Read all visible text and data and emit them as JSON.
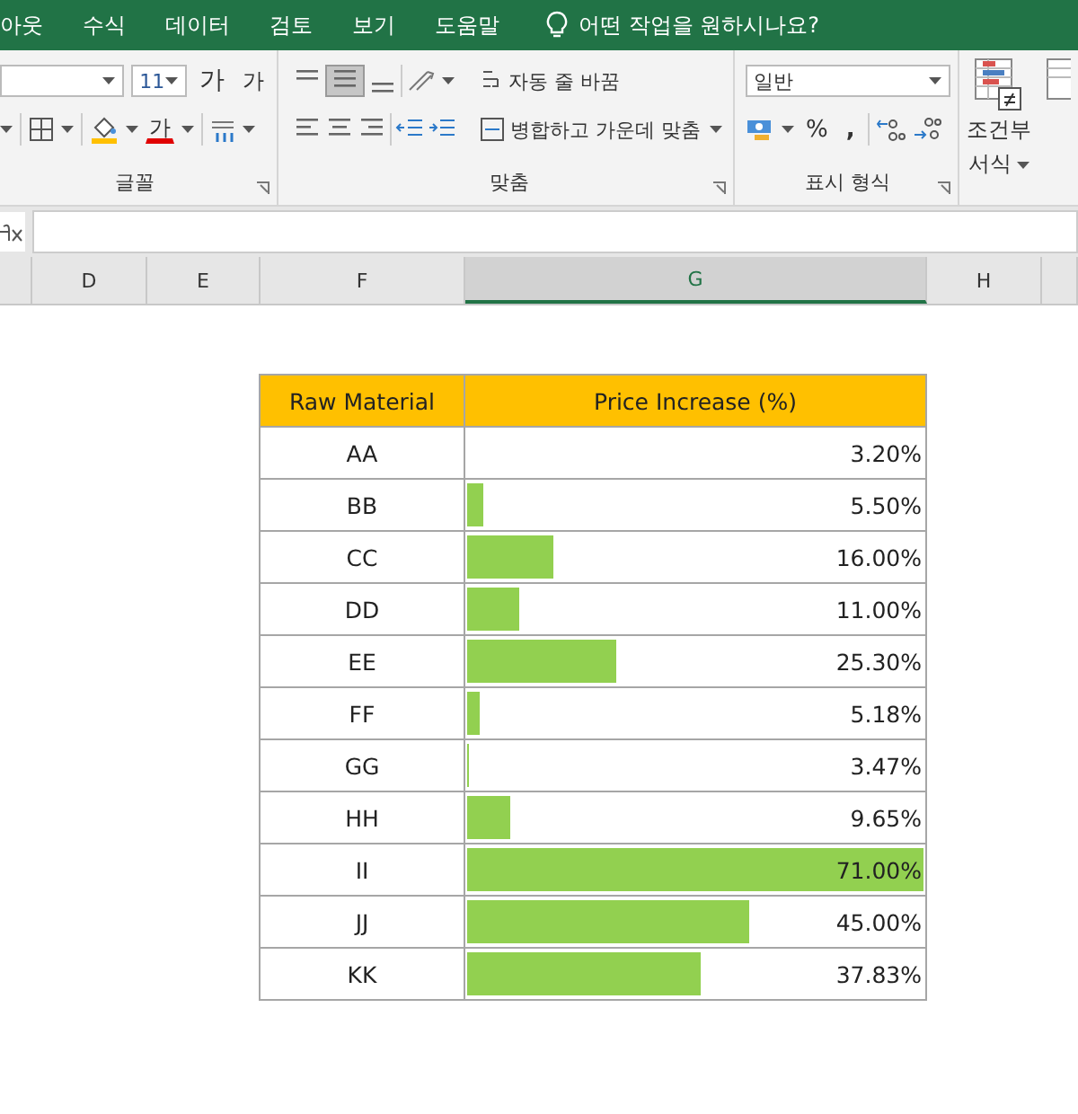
{
  "menu_tabs": [
    {
      "label": "아웃"
    },
    {
      "label": "수식"
    },
    {
      "label": "데이터"
    },
    {
      "label": "검토"
    },
    {
      "label": "보기"
    },
    {
      "label": "도움말"
    }
  ],
  "tell_me": "어떤 작업을 원하시나요?",
  "ribbon": {
    "font": {
      "size": "11",
      "grow": "가",
      "shrink": "가",
      "color_letter": "가",
      "label": "글꼴"
    },
    "alignment": {
      "middle_align_selected": true,
      "wrap": "자동 줄 바꿈",
      "merge": "병합하고 가운데 맞춤",
      "label": "맞춤"
    },
    "number": {
      "format": "일반",
      "percent": "%",
      "comma": ",",
      "label": "표시 형식"
    },
    "styles": {
      "conditional": "조건부",
      "conditional_2": "서식"
    }
  },
  "column_headers": [
    {
      "label": "D",
      "selected": false
    },
    {
      "label": "E",
      "selected": false
    },
    {
      "label": "F",
      "selected": false
    },
    {
      "label": "G",
      "selected": true
    },
    {
      "label": "H",
      "selected": false
    }
  ],
  "table": {
    "columns": [
      "Raw Material",
      "Price Increase (%)"
    ],
    "rows": [
      {
        "material": "AA",
        "value": "3.20%",
        "level": 0
      },
      {
        "material": "BB",
        "value": "5.50%",
        "level": 0.034
      },
      {
        "material": "CC",
        "value": "16.00%",
        "level": 0.189
      },
      {
        "material": "DD",
        "value": "11.00%",
        "level": 0.115
      },
      {
        "material": "EE",
        "value": "25.30%",
        "level": 0.326
      },
      {
        "material": "FF",
        "value": "5.18%",
        "level": 0.029
      },
      {
        "material": "GG",
        "value": "3.47%",
        "level": 0.004
      },
      {
        "material": "HH",
        "value": "9.65%",
        "level": 0.095
      },
      {
        "material": "II",
        "value": "71.00%",
        "level": 1
      },
      {
        "material": "JJ",
        "value": "45.00%",
        "level": 0.617
      },
      {
        "material": "KK",
        "value": "37.83%",
        "level": 0.511
      }
    ]
  }
}
